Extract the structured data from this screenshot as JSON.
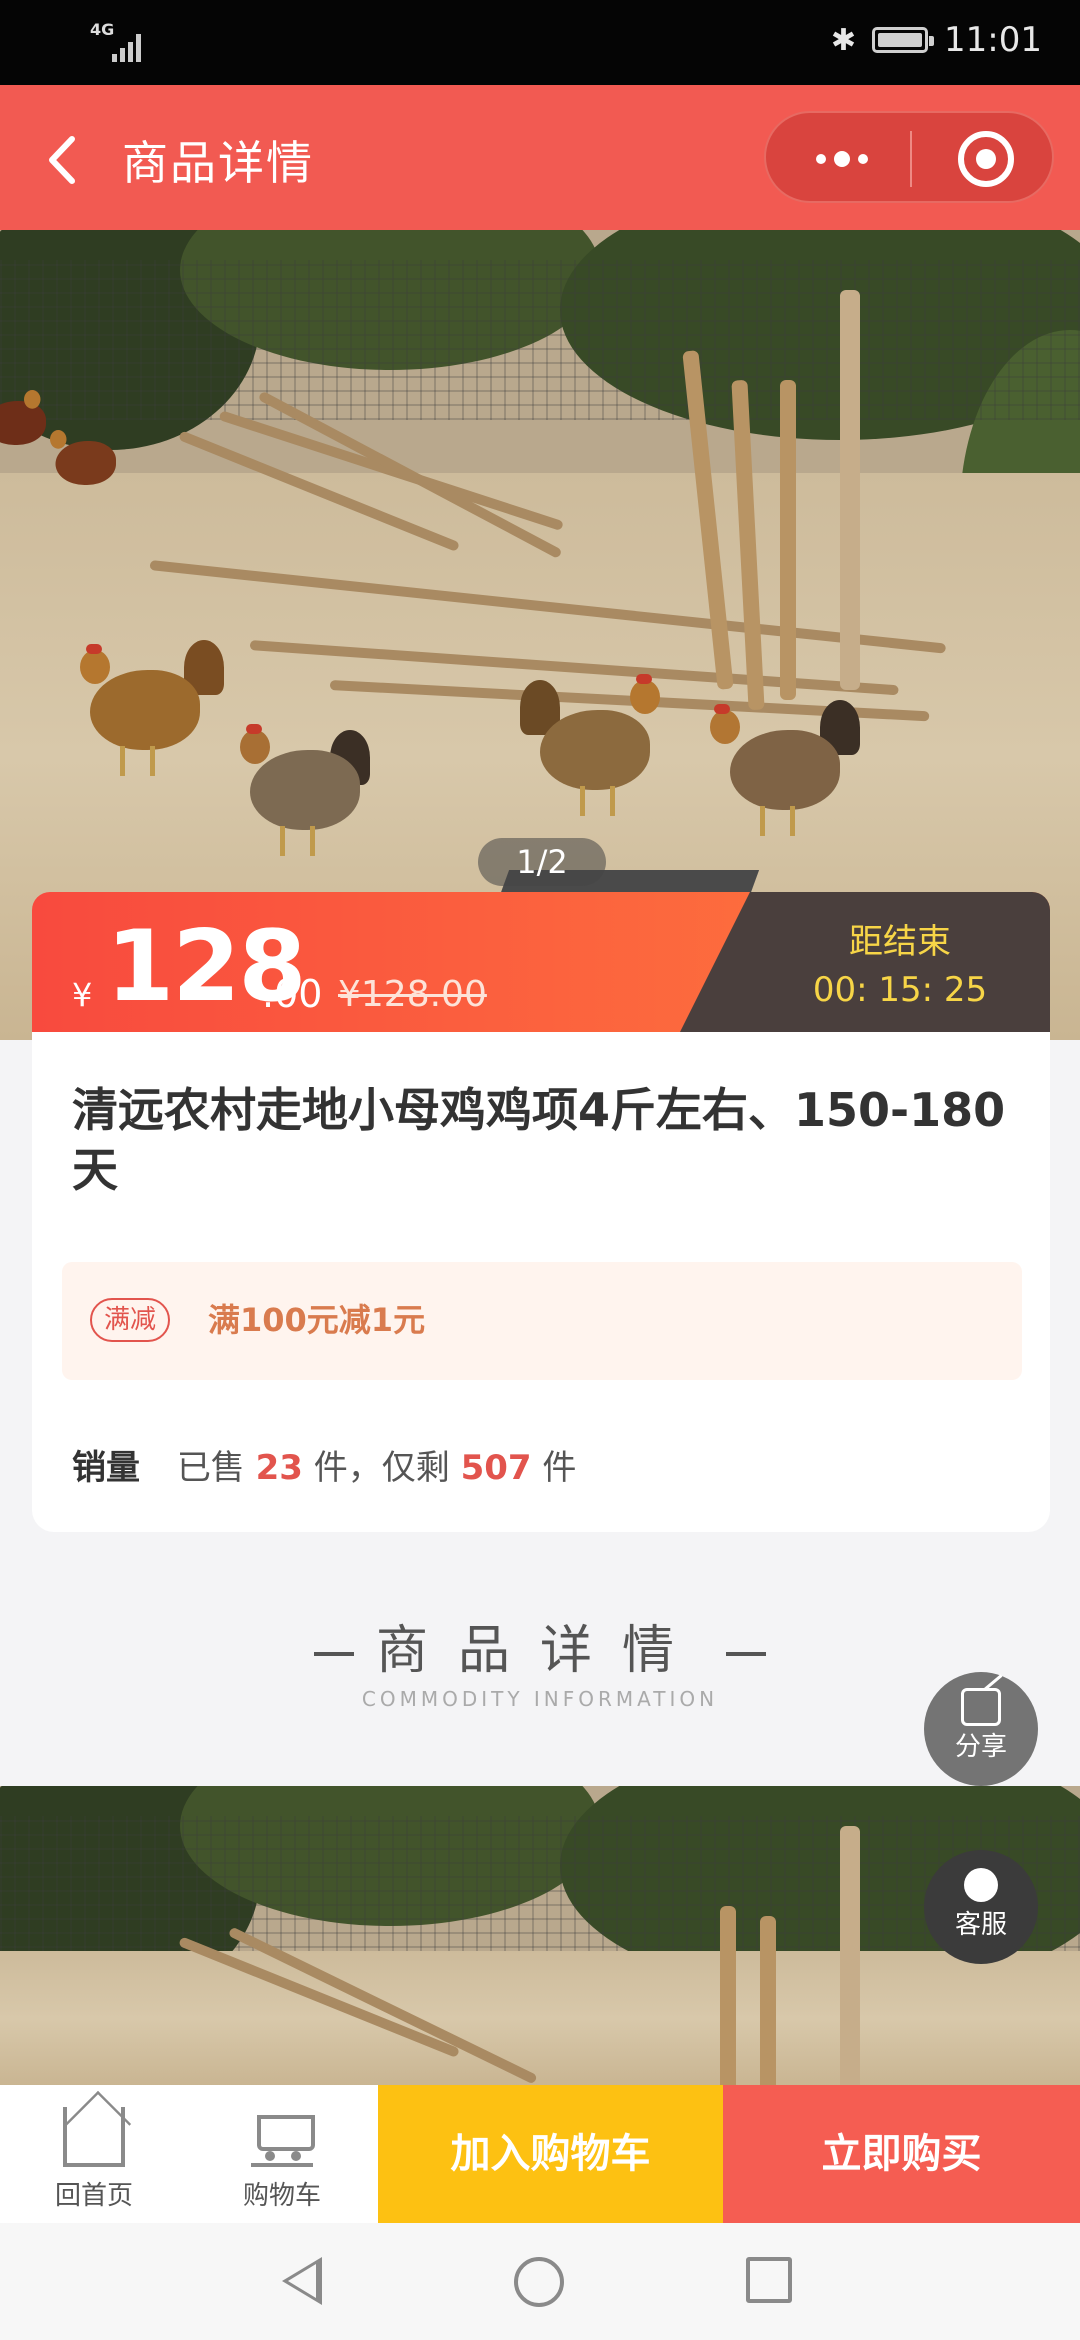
{
  "status_bar": {
    "network": "4G",
    "time": "11:01"
  },
  "header": {
    "title": "商品详情"
  },
  "gallery": {
    "pager": "1/2"
  },
  "price": {
    "currency": "¥",
    "integer": "128",
    "decimal": ".00",
    "original": "¥128.00",
    "countdown_label": "距结束",
    "countdown": "00: 15: 25"
  },
  "product": {
    "name": "清远农村走地小母鸡鸡项4斤左右、150-180天",
    "promo_tag": "满减",
    "promo_text": "满100元减1元",
    "sales_label": "销量",
    "sold_prefix": "已售",
    "sold_count": "23",
    "sold_unit": "件，仅剩",
    "remaining_count": "507",
    "remaining_unit": "件"
  },
  "detail_heading": {
    "title": "商品详情",
    "subtitle": "COMMODITY INFORMATION"
  },
  "floating": {
    "share": "分享",
    "service": "客服"
  },
  "bottom_bar": {
    "home": "回首页",
    "cart": "购物车",
    "add_to_cart": "加入购物车",
    "buy_now": "立即购买"
  },
  "colors": {
    "header_red": "#f25a52",
    "price_orange": "#ff7a3d",
    "add_cart_yellow": "#fdc112",
    "buy_red": "#f55d52",
    "countdown_yellow": "#f7d547"
  },
  "icons": [
    "back-arrow-icon",
    "more-dots-icon",
    "close-target-icon",
    "share-icon",
    "customer-service-icon",
    "home-icon",
    "cart-icon"
  ]
}
